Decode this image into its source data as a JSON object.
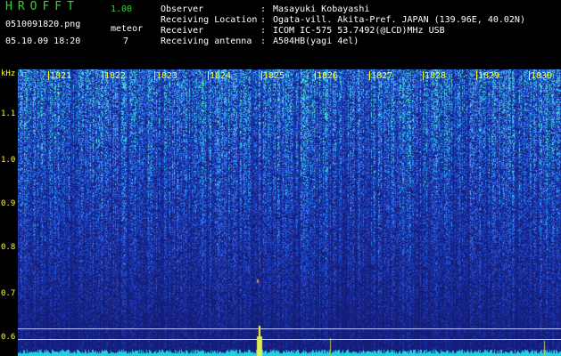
{
  "header": {
    "logo": "HROFFT",
    "version": "1.00",
    "filename": "0510091820.png",
    "datetime": "05.10.09 18:20",
    "meteor_label": "meteor",
    "meteor_count": "7"
  },
  "info": [
    {
      "key": "Observer",
      "sep": ":",
      "value": "Masayuki Kobayashi"
    },
    {
      "key": "Receiving Location",
      "sep": ":",
      "value": "Ogata-vill. Akita-Pref. JAPAN (139.96E, 40.02N)"
    },
    {
      "key": "Receiver",
      "sep": ":",
      "value": "ICOM IC-575 53.7492(@LCD)MHz USB"
    },
    {
      "key": "Receiving antenna",
      "sep": ":",
      "value": "A504HB(yagi 4el)"
    }
  ],
  "y_axis": {
    "unit": "kHz",
    "ticks": [
      "1.1",
      "1.0",
      "0.9",
      "0.8",
      "0.7",
      "0.6"
    ]
  },
  "time_axis": {
    "ticks": [
      "1821",
      "1822",
      "1823",
      "1824",
      "1825",
      "1826",
      "1827",
      "1828",
      "1829",
      "1830"
    ]
  },
  "colors": {
    "background": "#000000",
    "text_green": "#22dd22",
    "text_yellow": "#ffff22",
    "spectrogram_base": "#1a2f9a",
    "noise_bright": "#36c8ff",
    "meteor_echo": "#ffff22",
    "baseline": "#22d0e0"
  }
}
